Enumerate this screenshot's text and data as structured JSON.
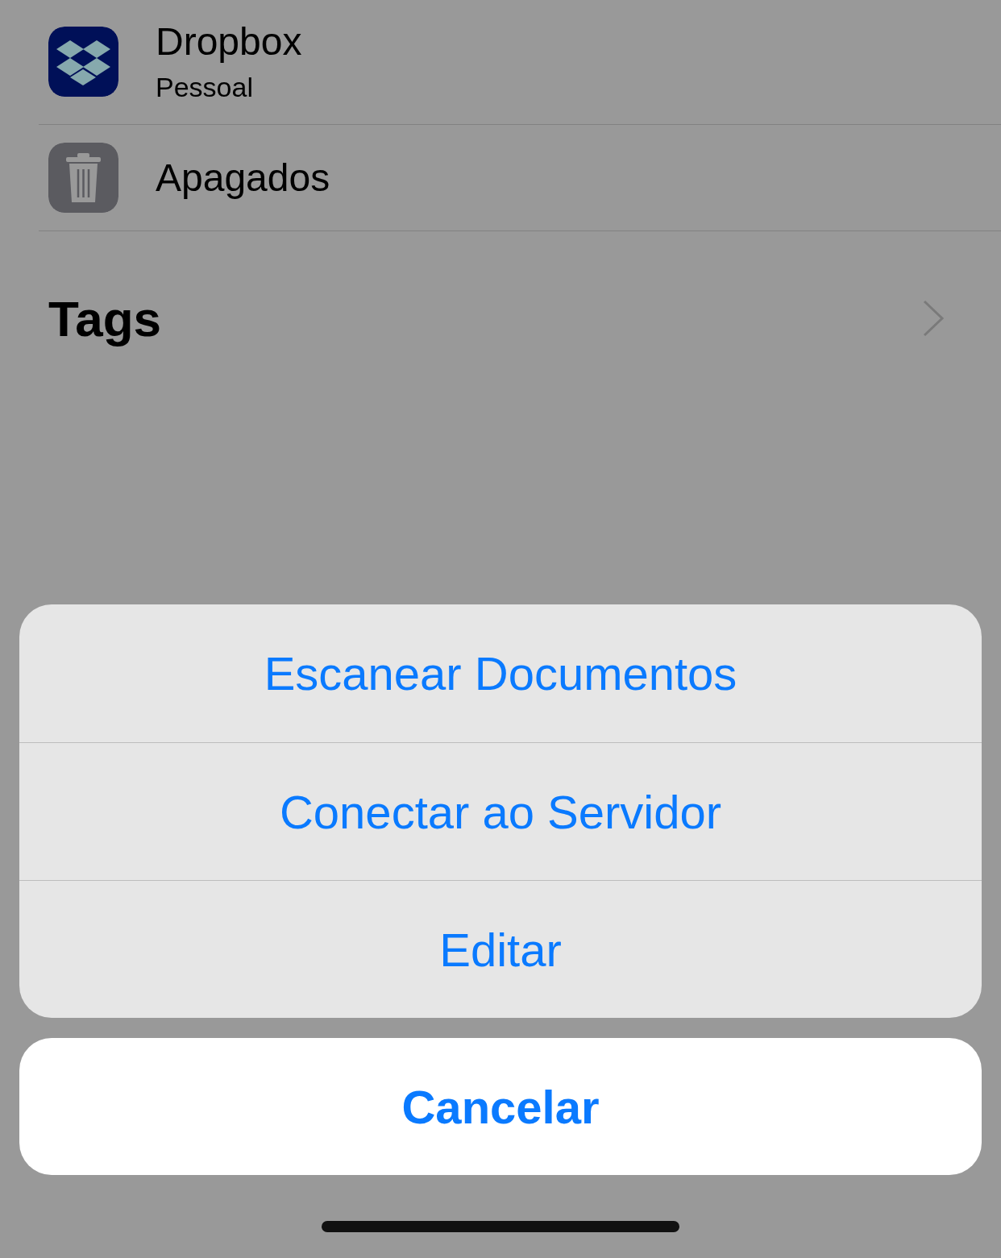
{
  "locations": [
    {
      "kind": "dropbox",
      "name": "Dropbox",
      "subtitle": "Pessoal"
    },
    {
      "kind": "trash",
      "name": "Apagados"
    }
  ],
  "tags_section": {
    "title": "Tags"
  },
  "action_sheet": {
    "actions": [
      "Escanear Documentos",
      "Conectar ao Servidor",
      "Editar"
    ],
    "cancel": "Cancelar"
  }
}
